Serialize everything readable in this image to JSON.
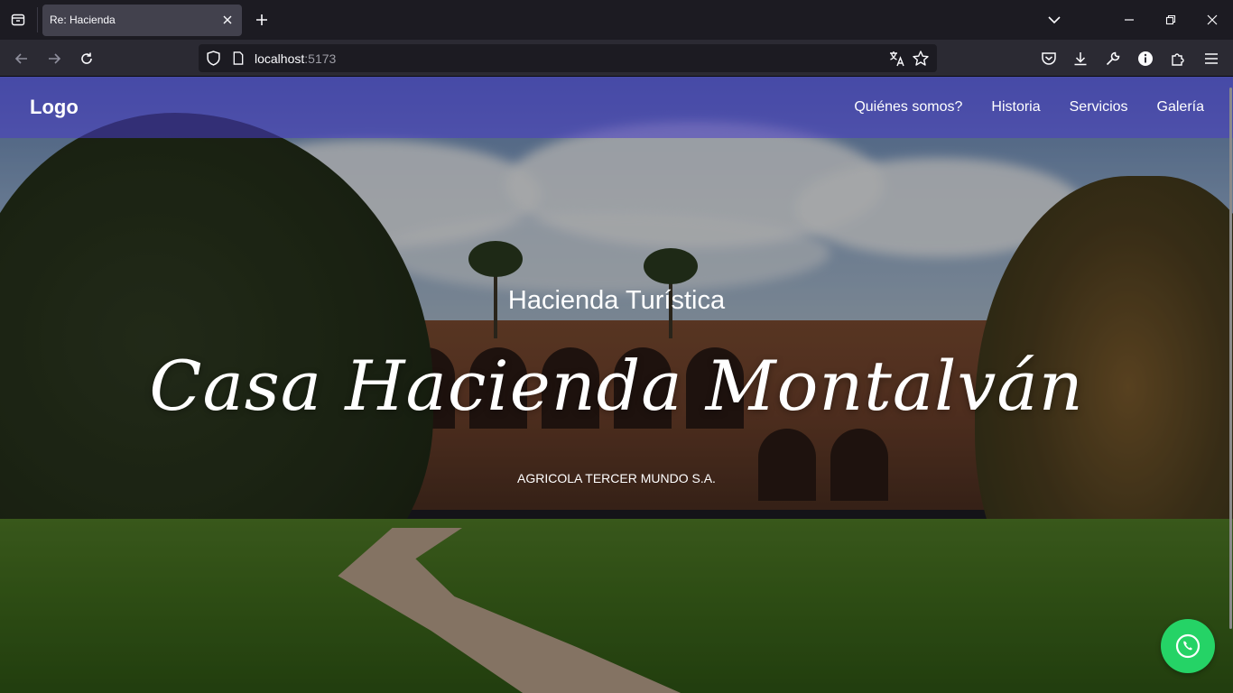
{
  "browser": {
    "tab_title": "Re: Hacienda",
    "url_host": "localhost",
    "url_port": ":5173"
  },
  "site": {
    "logo": "Logo",
    "menu": [
      "Quiénes somos?",
      "Historia",
      "Servicios",
      "Galería"
    ]
  },
  "hero": {
    "subtitle": "Hacienda Turística",
    "title": "Casa Hacienda Montalván",
    "company": "AGRICOLA TERCER MUNDO S.A."
  },
  "colors": {
    "header_overlay": "#483cc8",
    "whatsapp": "#25d366"
  },
  "icons": {
    "float_button": "whatsapp-phone-icon"
  }
}
